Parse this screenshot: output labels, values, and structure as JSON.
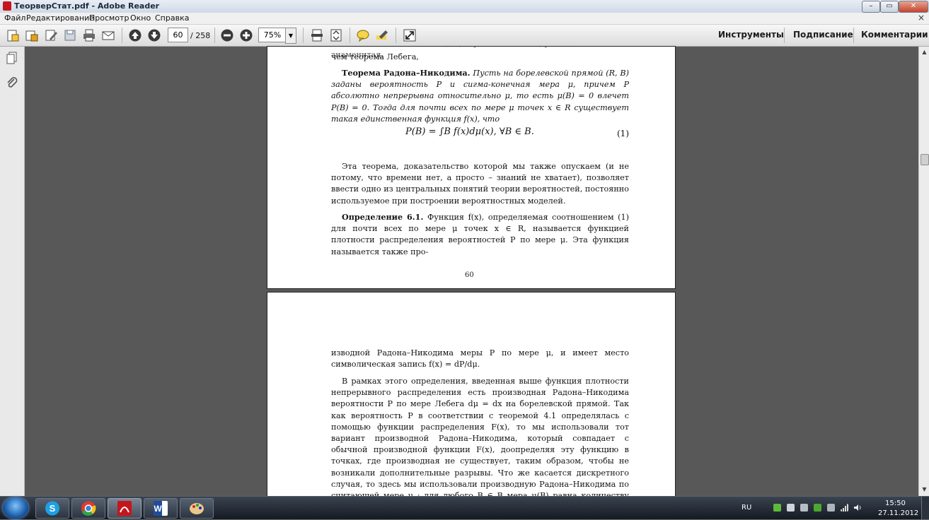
{
  "window": {
    "title": "ТеорверСтат.pdf - Adobe Reader",
    "minimize": "–",
    "maximize": "▭",
    "close": "✕"
  },
  "menu": {
    "items": [
      "Файл",
      "Редактирование",
      "Просмотр",
      "Окно",
      "Справка"
    ],
    "close_glyph": "×"
  },
  "toolbar": {
    "current_page": "60",
    "total_pages": "/ 258",
    "zoom": "75%",
    "zoom_dropdown": "▼",
    "tools_label": "Инструменты",
    "sign_label": "Подписание",
    "comments_label": "Комментарии"
  },
  "document": {
    "page1": {
      "cut_line": "личных типов. Этот подход указывает следующая, не менее знаменитая,",
      "intro_line": "чем теорема Лебега,",
      "theorem_title": "Теорема Радона–Никодима.",
      "theorem_text": "Пусть на борелевской прямой (R, B) заданы вероятность P и сигма-конечная мера μ, причем P абсолютно непрерывна относительно μ, то есть μ(B) = 0 влечет P(B) = 0. Тогда для почти всех по мере μ точек x ∈ R существует такая единственная функция f(x), что",
      "formula": "P(B) = ∫B f(x)dμ(x),    ∀B ∈ B.",
      "formula_number": "(1)",
      "paragraph": "Эта теорема, доказательство которой мы также опускаем (и не потому, что времени нет, а просто – знаний не хватает), позволяет ввести одно из центральных понятий теории вероятностей, постоянно используемое при построении вероятностных моделей.",
      "definition_title": "Определение 6.1.",
      "definition_text": "Функция f(x), определяемая соотношением (1) для почти всех по мере μ точек x ∈ R, называется функцией плотности распределения вероятностей P по мере μ. Эта функция называется также про-",
      "page_number": "60"
    },
    "page2": {
      "first_paragraph": "изводной Радона–Никодима меры P по мере μ, и имеет место символическая запись f(x) = dP/dμ.",
      "second_paragraph": "В рамках этого определения, введенная выше функция плотности непрерывного распределения есть производная Радона–Никодима вероятности P по мере Лебега dμ = dx на борелевской прямой. Так как вероятность P в соответствии с теоремой 4.1 определялась с помощью функции распределения F(x), то мы использовали тот вариант производной Радона–Никодима, который совпадает с обычной производной функции F(x), доопределяя эту функцию в точках, где производная не существует, таким образом, чтобы не возникали дополнительные разрывы. Что же касается дискретного случая, то здесь мы использовали производную Радона–Никодима по считающей мере μ : для любого B ∈ B мера μ(B) равна количеству точек с"
    }
  },
  "taskbar": {
    "language": "RU",
    "time": "15:50",
    "date": "27.11.2012"
  },
  "colors": {
    "adobe_red": "#c4161c",
    "taskbar_dark": "#151a22",
    "doc_background": "#585858"
  },
  "icons": {
    "toolbar": [
      "create-pdf-icon",
      "open-icon",
      "edit-icon",
      "save-icon",
      "print-icon",
      "email-icon",
      "page-up-icon",
      "page-down-icon",
      "zoom-out-icon",
      "zoom-in-icon",
      "fit-page-icon",
      "fit-width-icon",
      "comment-icon",
      "highlight-icon",
      "fullscreen-icon"
    ],
    "nav": [
      "page-thumbnails-icon",
      "attachments-icon"
    ],
    "taskbar": [
      "skype-icon",
      "chrome-icon",
      "adobe-reader-icon",
      "word-icon",
      "paint-icon"
    ]
  }
}
